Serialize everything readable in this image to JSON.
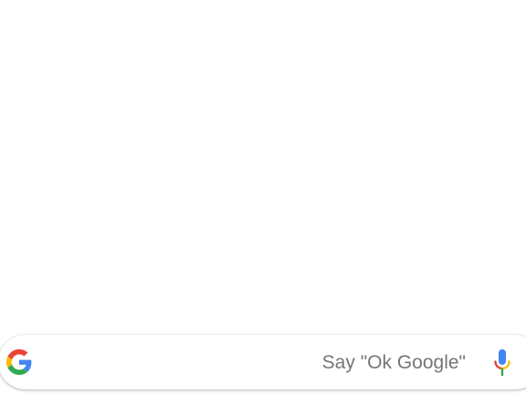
{
  "search_widget": {
    "hint": "Say \"Ok Google\"",
    "logo_icon": "google-g-icon",
    "mic_icon": "microphone-icon"
  },
  "colors": {
    "background": "#ffffff",
    "hint_text": "#757575",
    "google_blue": "#4285F4",
    "google_red": "#EA4335",
    "google_yellow": "#FBBC05",
    "google_green": "#34A853"
  }
}
